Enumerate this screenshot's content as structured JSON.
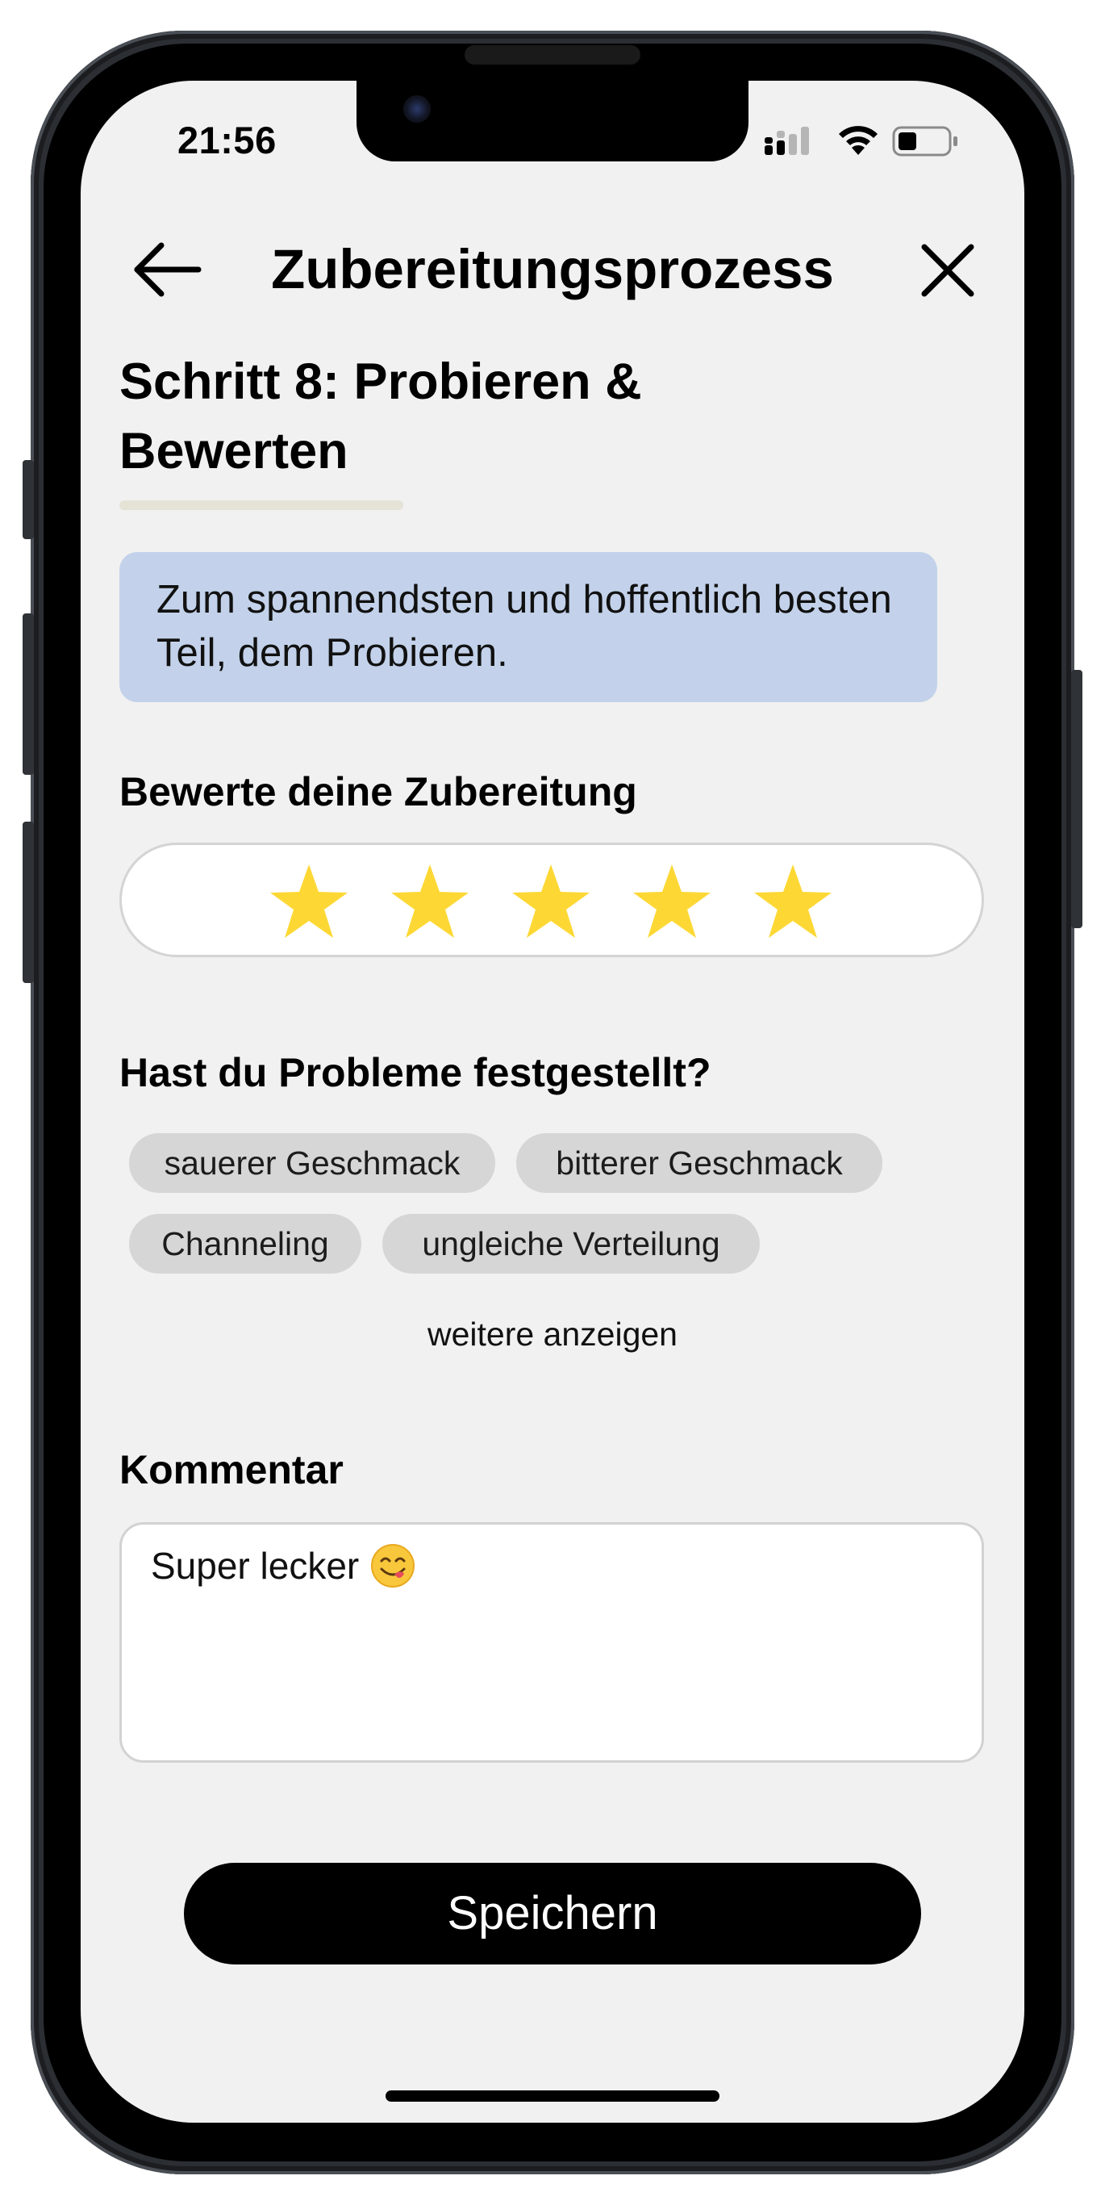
{
  "status_bar": {
    "time": "21:56"
  },
  "nav": {
    "title": "Zubereitungsprozess"
  },
  "step": {
    "title": "Schritt 8: Probieren & Bewerten",
    "info": "Zum spannendsten und hoffentlich besten Teil, dem Probieren."
  },
  "rating": {
    "label": "Bewerte deine Zubereitung",
    "value": 5,
    "max": 5,
    "star_color": "#FDD835"
  },
  "problems": {
    "label": "Hast du Probleme festgestellt?",
    "chips": [
      "sauerer Geschmack",
      "bitterer Geschmack",
      "Channeling",
      "ungleiche Verteilung"
    ],
    "more_label": "weitere anzeigen"
  },
  "comment": {
    "label": "Kommentar",
    "value": "Super lecker",
    "emoji": "face-savoring-food-icon"
  },
  "save_label": "Speichern",
  "colors": {
    "info_box": "#C3D2EA",
    "chip": "#D6D6D6",
    "button": "#000000",
    "background": "#F1F1F1"
  }
}
